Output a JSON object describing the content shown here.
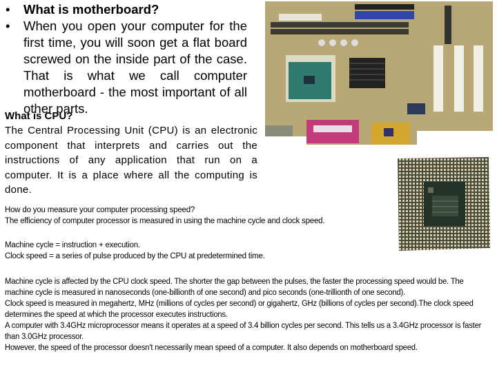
{
  "bullets": [
    {
      "text": "What is motherboard?",
      "bold": true
    },
    {
      "text": "When you open your computer for the first time, you will soon get a flat board screwed on the inside part of the case. That is what we call computer motherboard - the most important of all other parts."
    }
  ],
  "bullet_glyph": "•",
  "cpu_section": {
    "heading": "What is CPU?",
    "body": "The Central Processing Unit (CPU) is an electronic component that interprets and carries out the instructions of any application that run on a computer. It is a place where all the computing is done."
  },
  "speed_section": {
    "question": "How do you measure your computer processing speed?",
    "answer": "The efficiency of computer processor is measured in using the machine cycle and clock speed.",
    "definitions": [
      "Machine cycle = instruction + execution.",
      "Clock speed = a series of pulse produced by the CPU at predetermined time."
    ],
    "paragraphs": [
      "Machine cycle is affected by the CPU clock speed. The shorter the gap between the pulses, the faster the processing speed would be. The machine cycle is measured in nanoseconds (one-billionth of one second) and pico seconds (one-trillionth of one second).",
      "Clock speed is measured in megahertz, MHz (millions of cycles per second) or gigahertz, GHz (billions of cycles per second).The clock speed determines the speed at which the processor executes instructions.",
      "A computer with 3.4GHz microprocessor means it operates at a speed of 3.4 billion cycles per second. This tells us a 3.4GHz processor is faster than 3.0GHz processor.",
      "However, the speed of the processor doesn't necessarily mean speed of a computer. It also depends on motherboard speed."
    ]
  },
  "images": {
    "motherboard_alt": "motherboard photo",
    "cpu_alt": "CPU processor photo"
  }
}
